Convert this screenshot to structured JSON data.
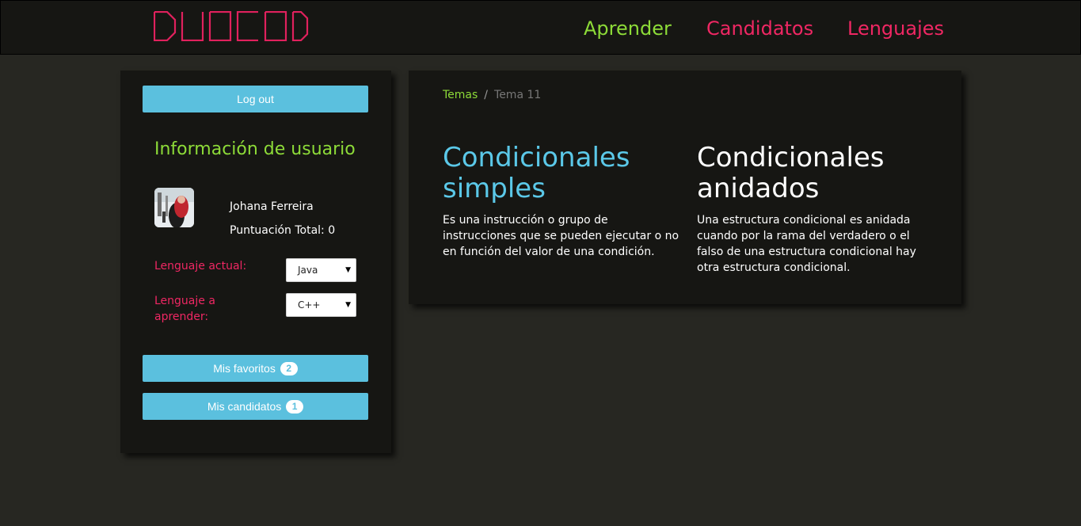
{
  "header": {
    "logo_text": "DUOCODE",
    "nav": [
      {
        "label": "Aprender"
      },
      {
        "label": "Candidatos"
      },
      {
        "label": "Lenguajes"
      }
    ]
  },
  "colors": {
    "accent_green": "#8ddb38",
    "accent_pink": "#ef2763",
    "button_blue": "#5bc0de",
    "title_blue": "#5bc8e8",
    "background": "#272722",
    "panel": "#161613"
  },
  "sidebar": {
    "logout_label": "Log out",
    "info_title": "Información de usuario",
    "user_name": "Johana Ferreira",
    "score_label": "Puntuación Total: 0",
    "current_language_label": "Lenguaje actual:",
    "current_language_value": "Java",
    "learn_language_label": "Lenguaje a aprender:",
    "learn_language_value": "C++",
    "favorites_label": "Mis favoritos",
    "favorites_count": "2",
    "candidates_label": "Mis candidatos",
    "candidates_count": "1"
  },
  "main": {
    "breadcrumb": {
      "root": "Temas",
      "separator": "/",
      "current": "Tema 11"
    },
    "topics": [
      {
        "title": "Condicionales simples",
        "description": "Es una instrucción o grupo de instrucciones que se pueden ejecutar o no en función del valor de una condición."
      },
      {
        "title": "Condicionales anidados",
        "description": "Una estructura condicional es anidada cuando por la rama del verdadero o el falso de una estructura condicional hay otra estructura condicional."
      }
    ]
  }
}
